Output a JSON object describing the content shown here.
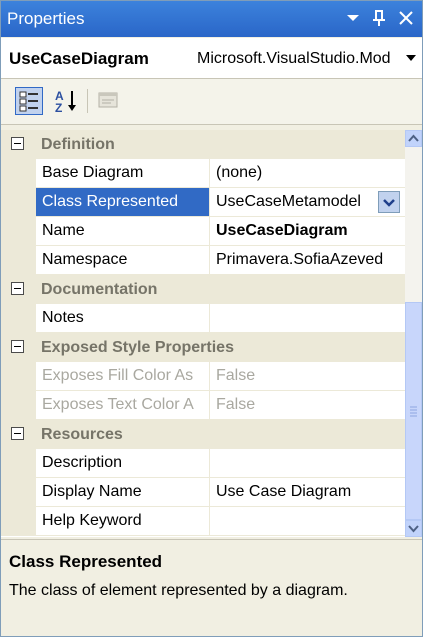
{
  "titlebar": {
    "title": "Properties",
    "pin_glyph": "↓ ѥ",
    "close_glyph": "✕"
  },
  "object_selector": {
    "name": "UseCaseDiagram",
    "type": "Microsoft.VisualStudio.Mod"
  },
  "grid": {
    "categories": {
      "definition": "Definition",
      "documentation": "Documentation",
      "exposed_style": "Exposed Style Properties",
      "resources": "Resources"
    },
    "rows": {
      "base_diagram": {
        "name": "Base Diagram",
        "value": "(none)"
      },
      "class_represented": {
        "name": "Class Represented",
        "value": "UseCaseMetamodel"
      },
      "name": {
        "name": "Name",
        "value": "UseCaseDiagram"
      },
      "namespace": {
        "name": "Namespace",
        "value": "Primavera.SofiaAzeved"
      },
      "notes": {
        "name": "Notes",
        "value": ""
      },
      "exposes_fill": {
        "name": "Exposes Fill Color As",
        "value": "False"
      },
      "exposes_text": {
        "name": "Exposes Text Color A",
        "value": "False"
      },
      "description": {
        "name": "Description",
        "value": ""
      },
      "display_name": {
        "name": "Display Name",
        "value": "Use Case Diagram"
      },
      "help_keyword": {
        "name": "Help Keyword",
        "value": ""
      }
    }
  },
  "description_pane": {
    "title": "Class Represented",
    "text": "The class of element represented by a diagram."
  }
}
